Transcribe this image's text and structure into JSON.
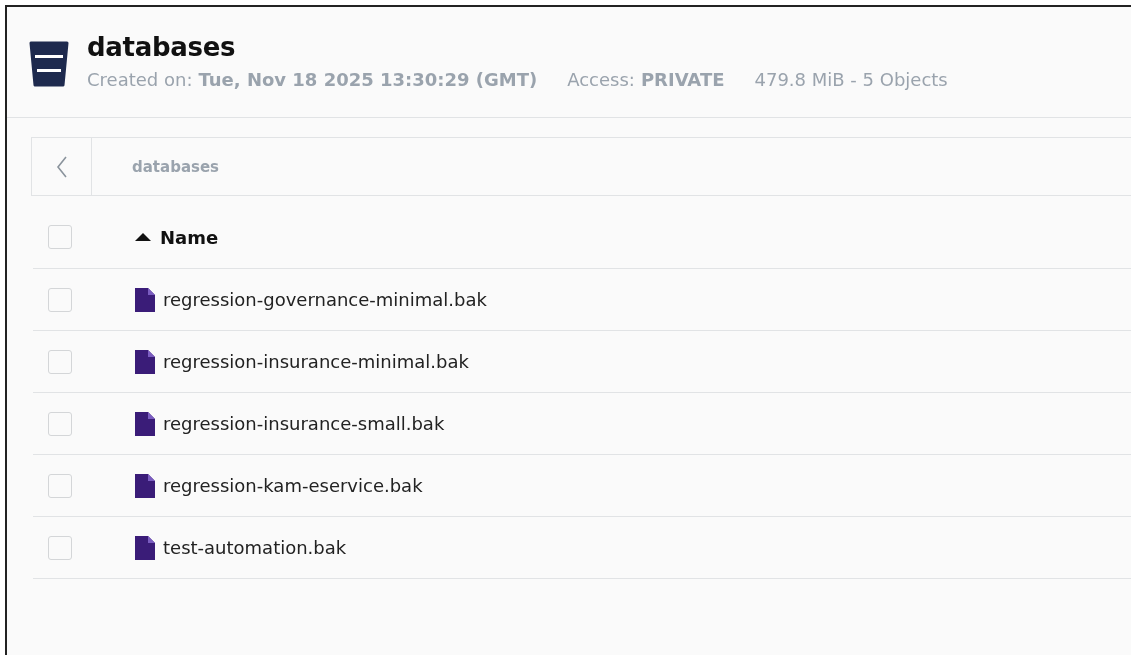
{
  "header": {
    "title": "databases",
    "created_label": "Created on:",
    "created_value": "Tue, Nov 18 2025 13:30:29 (GMT)",
    "access_label": "Access:",
    "access_value": "PRIVATE",
    "usage": "479.8 MiB - 5 Objects"
  },
  "breadcrumb": {
    "path": "databases"
  },
  "table": {
    "select_all": {
      "checked": false
    },
    "column": {
      "label": "Name",
      "sorted_ascending": true
    },
    "rows": [
      {
        "name": "regression-governance-minimal.bak",
        "checked": false
      },
      {
        "name": "regression-insurance-minimal.bak",
        "checked": false
      },
      {
        "name": "regression-insurance-small.bak",
        "checked": false
      },
      {
        "name": "regression-kam-eservice.bak",
        "checked": false
      },
      {
        "name": "test-automation.bak",
        "checked": false
      }
    ]
  }
}
